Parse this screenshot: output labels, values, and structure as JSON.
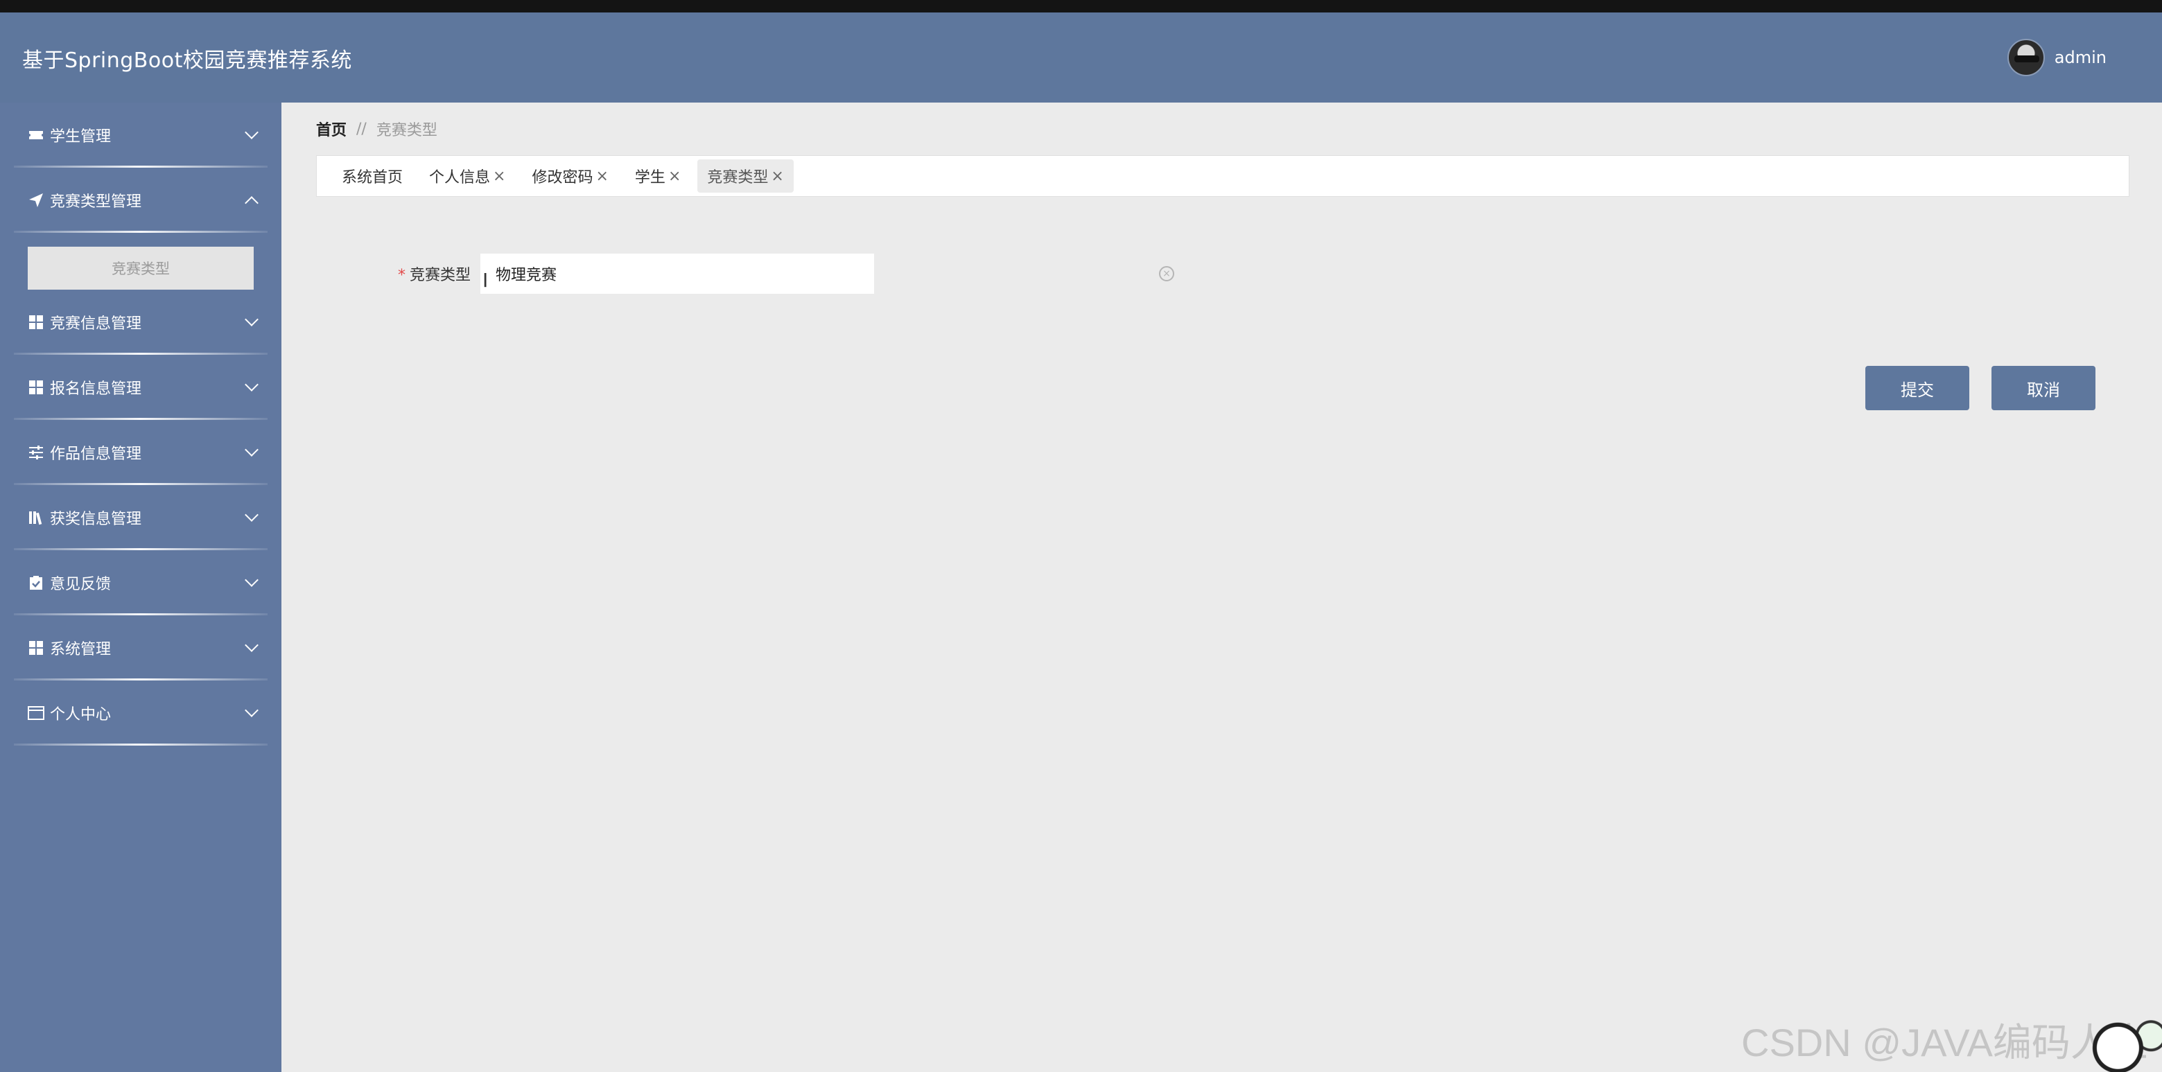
{
  "header": {
    "app_title": "基于SpringBoot校园竞赛推荐系统",
    "username": "admin"
  },
  "sidebar": {
    "items": [
      {
        "label": "学生管理",
        "icon": "ticket-icon",
        "expanded": false
      },
      {
        "label": "竞赛类型管理",
        "icon": "paper-plane-icon",
        "expanded": true,
        "children": [
          "竞赛类型"
        ]
      },
      {
        "label": "竞赛信息管理",
        "icon": "grid-icon",
        "expanded": false
      },
      {
        "label": "报名信息管理",
        "icon": "grid-icon",
        "expanded": false
      },
      {
        "label": "作品信息管理",
        "icon": "sliders-icon",
        "expanded": false
      },
      {
        "label": "获奖信息管理",
        "icon": "books-icon",
        "expanded": false
      },
      {
        "label": "意见反馈",
        "icon": "clipboard-check-icon",
        "expanded": false
      },
      {
        "label": "系统管理",
        "icon": "grid-icon",
        "expanded": false
      },
      {
        "label": "个人中心",
        "icon": "id-card-icon",
        "expanded": false
      }
    ]
  },
  "breadcrumb": {
    "home": "首页",
    "separator": "//",
    "current": "竞赛类型"
  },
  "tabs": [
    {
      "label": "系统首页",
      "closable": false
    },
    {
      "label": "个人信息",
      "closable": true
    },
    {
      "label": "修改密码",
      "closable": true
    },
    {
      "label": "学生",
      "closable": true
    },
    {
      "label": "竞赛类型",
      "closable": true,
      "active": true
    }
  ],
  "form": {
    "field_label": "竞赛类型",
    "required_mark": "*",
    "field_value": "物理竞赛",
    "submit_label": "提交",
    "cancel_label": "取消"
  },
  "watermark": "CSDN @JAVA编码人生",
  "colors": {
    "header_bg": "#5e779d",
    "sidebar_bg": "#6178a0",
    "content_bg": "#ebebeb",
    "button_bg": "#5e779d",
    "required": "#e24a4a"
  }
}
